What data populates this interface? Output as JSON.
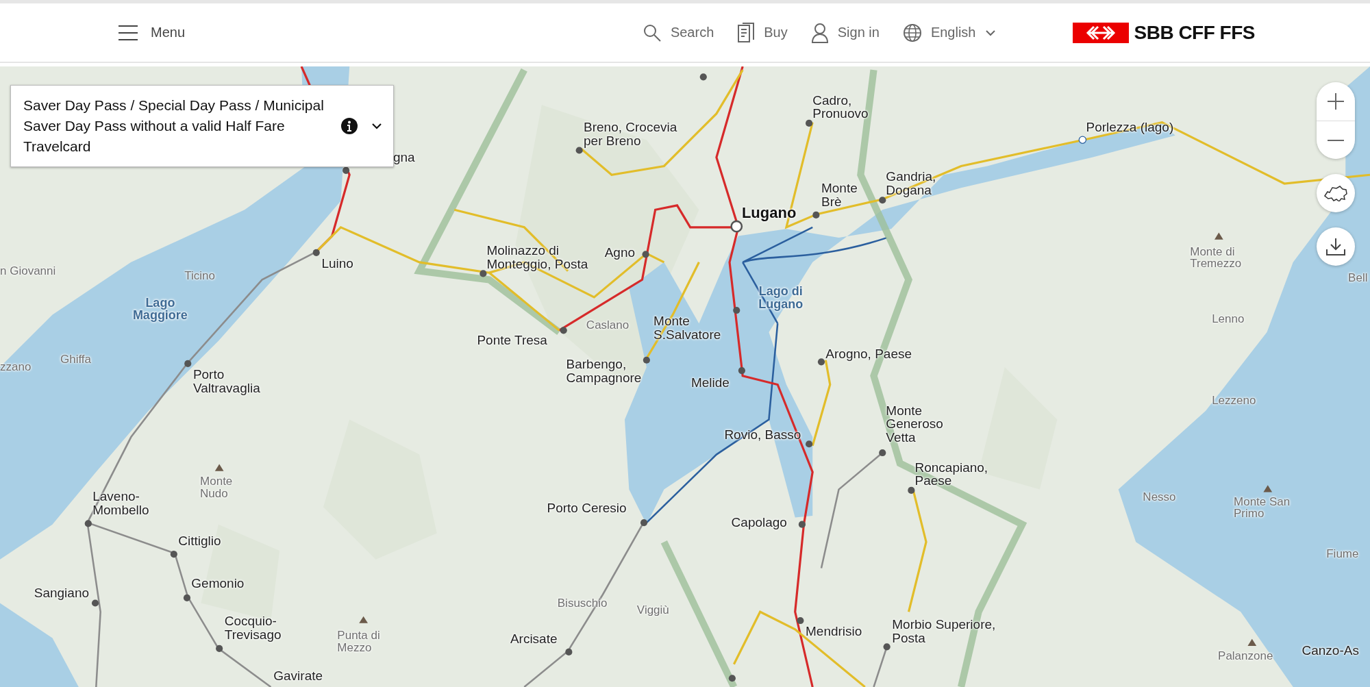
{
  "header": {
    "menu": "Menu",
    "nav": [
      {
        "label": "Search",
        "kind": "search"
      },
      {
        "label": "Buy",
        "kind": "buy"
      },
      {
        "label": "Sign in",
        "kind": "account"
      },
      {
        "label": "English",
        "kind": "language"
      }
    ],
    "logo": "SBB CFF FFS"
  },
  "ticket_selector": {
    "value": "Saver Day Pass / Special Day Pass / Municipal Saver Day Pass without a valid Half Fare Travelcard"
  },
  "map": {
    "labels": [
      {
        "text": "Cadro,\nPronuovo",
        "kind": "station"
      },
      {
        "text": "Breno, Crocevia\nper Breno",
        "kind": "station"
      },
      {
        "text": "Porlezza (lago)",
        "kind": "station"
      },
      {
        "text": "gna",
        "kind": "station"
      },
      {
        "text": "Gandria,\nDogana",
        "kind": "station"
      },
      {
        "text": "Monte\nBrè",
        "kind": "station"
      },
      {
        "text": "Lugano",
        "kind": "city"
      },
      {
        "text": "Molinazzo di\nMonteggio, Posta",
        "kind": "station"
      },
      {
        "text": "Agno",
        "kind": "station"
      },
      {
        "text": "Luino",
        "kind": "station"
      },
      {
        "text": "n Giovanni",
        "kind": "place"
      },
      {
        "text": "Ticino",
        "kind": "place"
      },
      {
        "text": "Lago\nMaggiore",
        "kind": "lake"
      },
      {
        "text": "Lago di\nLugano",
        "kind": "lake"
      },
      {
        "text": "Monte di\nTremezzo",
        "kind": "place"
      },
      {
        "text": "Bell",
        "kind": "place"
      },
      {
        "text": "Caslano",
        "kind": "place"
      },
      {
        "text": "Monte\nS.Salvatore",
        "kind": "station"
      },
      {
        "text": "Ponte Tresa",
        "kind": "station"
      },
      {
        "text": "Lenno",
        "kind": "place"
      },
      {
        "text": "Arogno, Paese",
        "kind": "station"
      },
      {
        "text": "Ghiffa",
        "kind": "place"
      },
      {
        "text": "zzano",
        "kind": "place"
      },
      {
        "text": "Barbengo,\nCampagnore",
        "kind": "station"
      },
      {
        "text": "Porto\nValtravaglia",
        "kind": "station"
      },
      {
        "text": "Melide",
        "kind": "station"
      },
      {
        "text": "Lezzeno",
        "kind": "place"
      },
      {
        "text": "Rovio, Basso",
        "kind": "station"
      },
      {
        "text": "Monte\nGeneroso\nVetta",
        "kind": "station"
      },
      {
        "text": "Roncapiano,\nPaese",
        "kind": "station"
      },
      {
        "text": "Monte\nNudo",
        "kind": "place"
      },
      {
        "text": "Laveno-\nMombello",
        "kind": "station"
      },
      {
        "text": "Porto Ceresio",
        "kind": "station"
      },
      {
        "text": "Capolago",
        "kind": "station"
      },
      {
        "text": "Nesso",
        "kind": "place"
      },
      {
        "text": "Monte San\nPrimo",
        "kind": "place"
      },
      {
        "text": "Cittiglio",
        "kind": "station"
      },
      {
        "text": "Fiume",
        "kind": "place"
      },
      {
        "text": "Gemonio",
        "kind": "station"
      },
      {
        "text": "Sangiano",
        "kind": "station"
      },
      {
        "text": "Bisuschio",
        "kind": "place"
      },
      {
        "text": "Viggiù",
        "kind": "place"
      },
      {
        "text": "Cocquio-\nTrevisago",
        "kind": "station"
      },
      {
        "text": "Punta di\nMezzo",
        "kind": "place"
      },
      {
        "text": "Arcisate",
        "kind": "station"
      },
      {
        "text": "Mendrisio",
        "kind": "station"
      },
      {
        "text": "Morbio Superiore,\nPosta",
        "kind": "station"
      },
      {
        "text": "Palanzone",
        "kind": "place"
      },
      {
        "text": "Canzo-As",
        "kind": "station"
      },
      {
        "text": "Gavirate",
        "kind": "station"
      }
    ]
  }
}
